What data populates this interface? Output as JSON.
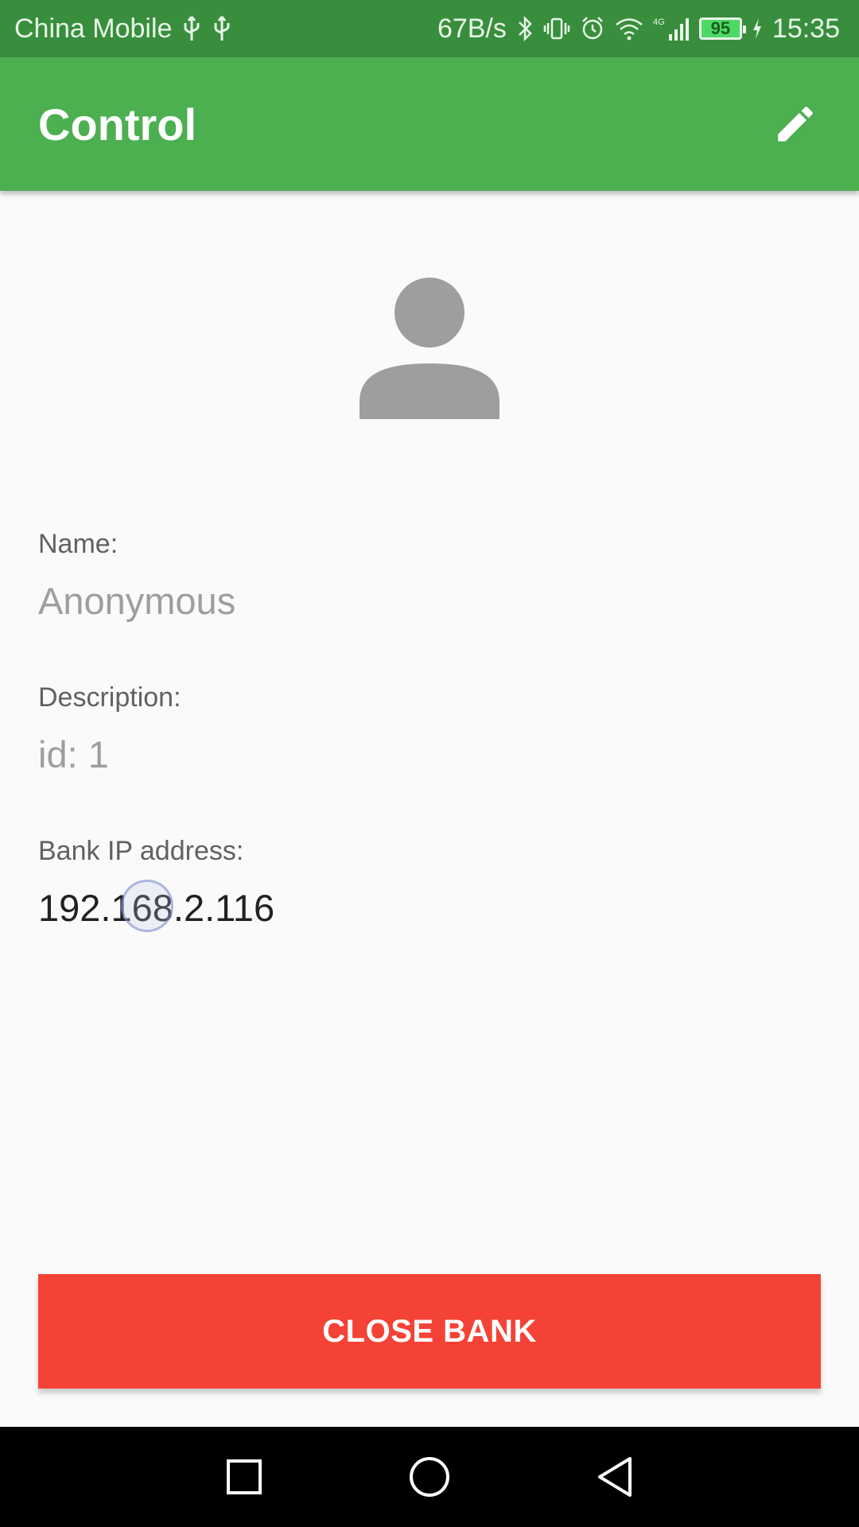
{
  "status_bar": {
    "carrier": "China Mobile",
    "net_speed": "67B/s",
    "signal_label": "4G",
    "battery": "95",
    "time": "15:35"
  },
  "app_bar": {
    "title": "Control",
    "edit_icon": "pencil-icon"
  },
  "profile": {
    "avatar_icon": "person-icon",
    "name_label": "Name:",
    "name_value": "Anonymous",
    "description_label": "Description:",
    "description_value": "id: 1",
    "ip_label": "Bank IP address:",
    "ip_value": "192.168.2.116"
  },
  "actions": {
    "close_bank_label": "CLOSE BANK",
    "close_bank_color": "#f44336"
  },
  "colors": {
    "primary": "#4caf50",
    "primary_dark": "#388e3c"
  },
  "nav_bar": {
    "recents_icon": "square-icon",
    "home_icon": "circle-icon",
    "back_icon": "triangle-back-icon"
  }
}
